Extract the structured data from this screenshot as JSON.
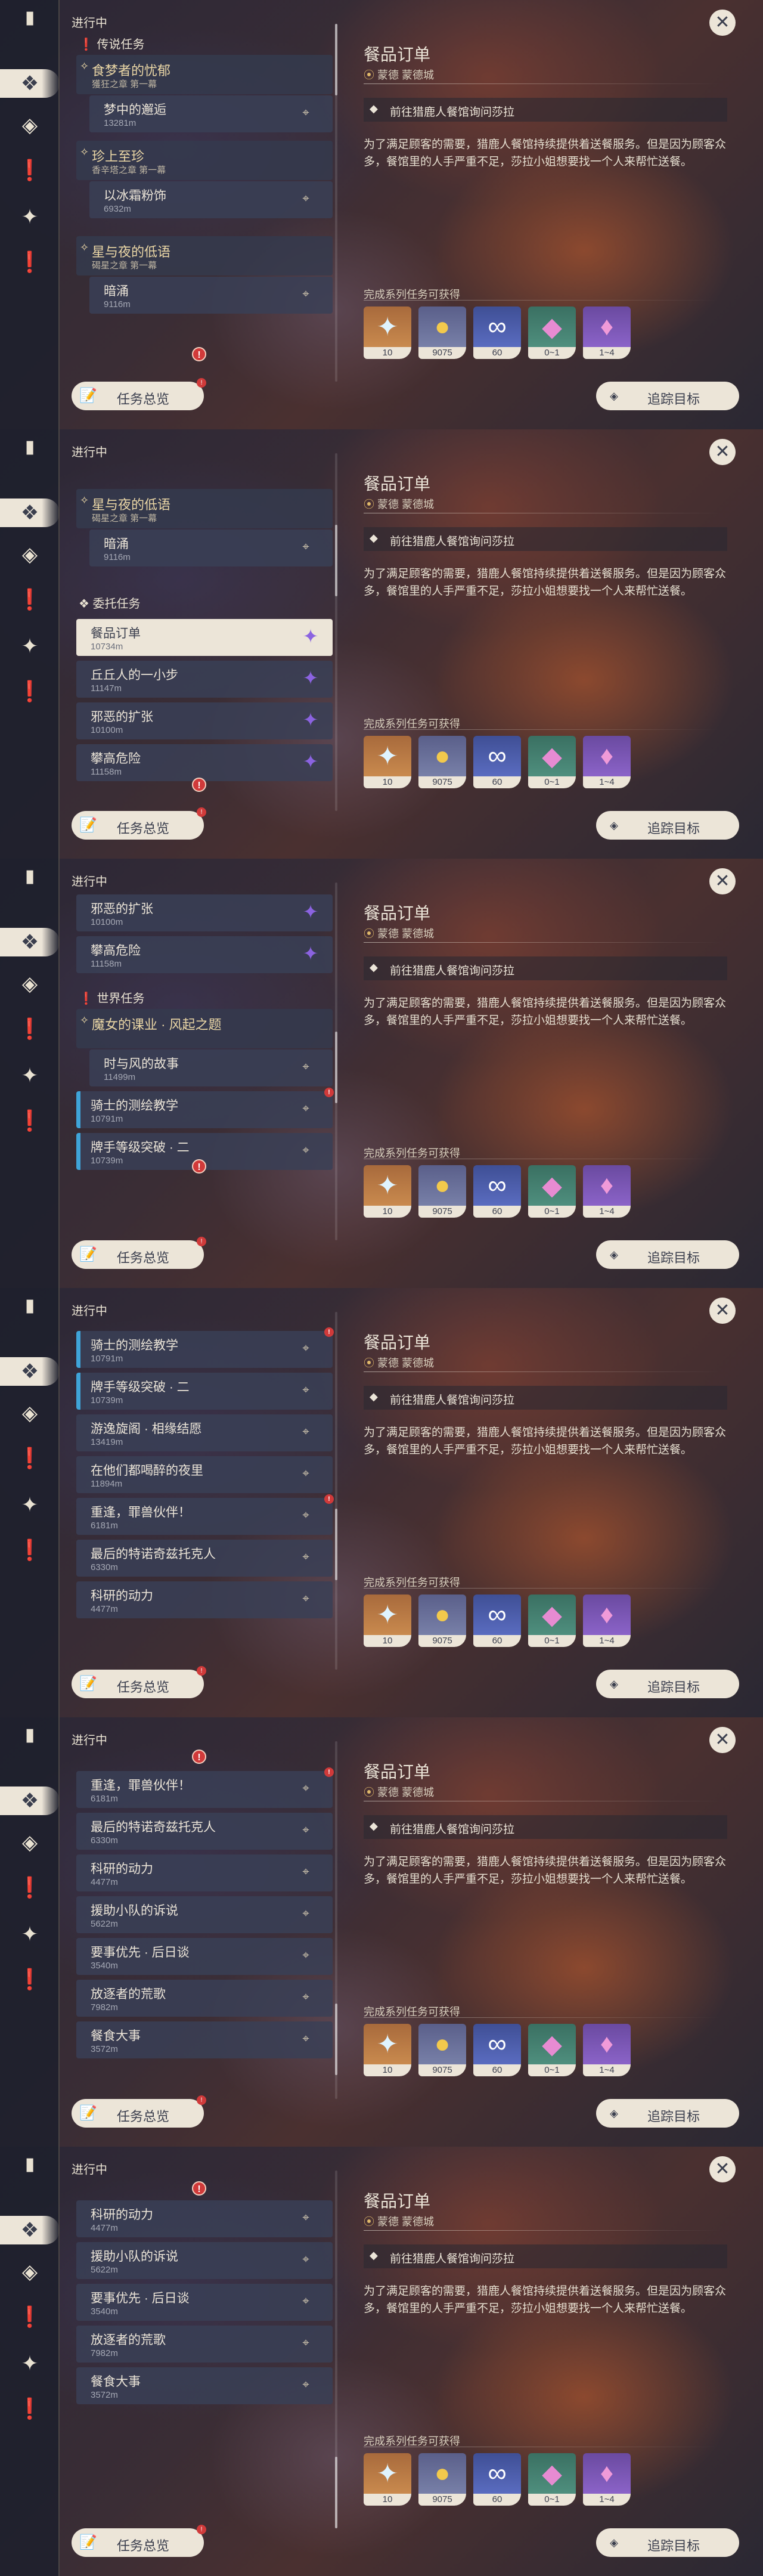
{
  "sidebar_icons": [
    "book-icon",
    "quest-diamond-icon",
    "compass-icon",
    "exclamation-icon",
    "crystal-icon",
    "exclamation-icon"
  ],
  "common": {
    "progress_label": "进行中",
    "overview_button": "任务总览",
    "track_button": "追踪目标",
    "close_glyph": "✕"
  },
  "detail": {
    "title": "餐品订单",
    "location_region": "蒙德",
    "location_city": "蒙德城",
    "step": "前往猎鹿人餐馆询问莎拉",
    "description": "为了满足顾客的需要，猎鹿人餐馆持续提供着送餐服务。但是因为顾客众多，餐馆里的人手严重不足，莎拉小姐想要找一个人来帮忙送餐。",
    "rewards_title": "完成系列任务可获得",
    "rewards": [
      {
        "icon": "primogem-icon",
        "count": "10"
      },
      {
        "icon": "mora-icon",
        "count": "9075"
      },
      {
        "icon": "hero-wit-icon",
        "count": "60"
      },
      {
        "icon": "crystal-chunk-icon",
        "count": "0~1"
      },
      {
        "icon": "amethyst-icon",
        "count": "1~4"
      }
    ]
  },
  "panels": [
    {
      "sections": [
        {
          "label": "传说任务"
        }
      ],
      "chapters": [
        {
          "title": "食梦者的忧郁",
          "sub": "獲狂之章 第一幕"
        },
        {
          "title": "珍上至珍",
          "sub": "香辛塔之章 第一幕"
        },
        {
          "title": "星与夜的低语",
          "sub": "碣星之章 第一幕"
        }
      ],
      "rows": [
        {
          "title": "梦中的邂逅",
          "dist": "13281m"
        },
        {
          "title": "以冰霜粉饰",
          "dist": "6932m"
        },
        {
          "title": "暗涌",
          "dist": "9116m"
        }
      ]
    },
    {
      "sections": [
        {
          "label": "委托任务"
        }
      ],
      "chapters": [
        {
          "title": "星与夜的低语",
          "sub": "碣星之章 第一幕"
        }
      ],
      "rows": [
        {
          "title": "暗涌",
          "dist": "9116m"
        },
        {
          "title": "餐品订单",
          "dist": "10734m"
        },
        {
          "title": "丘丘人的一小步",
          "dist": "11147m"
        },
        {
          "title": "邪恶的扩张",
          "dist": "10100m"
        },
        {
          "title": "攀高危险",
          "dist": "11158m"
        }
      ]
    },
    {
      "sections": [
        {
          "label": "世界任务"
        }
      ],
      "chapters": [
        {
          "title": "魔女的课业 · 风起之题",
          "sub": ""
        }
      ],
      "rows": [
        {
          "title": "邪恶的扩张",
          "dist": "10100m"
        },
        {
          "title": "攀高危险",
          "dist": "11158m"
        },
        {
          "title": "时与风的故事",
          "dist": "11499m"
        },
        {
          "title": "骑士的测绘教学",
          "dist": "10791m"
        },
        {
          "title": "牌手等级突破 · 二",
          "dist": "10739m"
        }
      ]
    },
    {
      "rows": [
        {
          "title": "骑士的测绘教学",
          "dist": "10791m"
        },
        {
          "title": "牌手等级突破 · 二",
          "dist": "10739m"
        },
        {
          "title": "游逸旋阁 · 相缘结愿",
          "dist": "13419m"
        },
        {
          "title": "在他们都喝醉的夜里",
          "dist": "11894m"
        },
        {
          "title": "重逢，罪兽伙伴！",
          "dist": "6181m"
        },
        {
          "title": "最后的特诺奇兹托克人",
          "dist": "6330m"
        },
        {
          "title": "科研的动力",
          "dist": "4477m"
        }
      ]
    },
    {
      "rows": [
        {
          "title": "重逢，罪兽伙伴！",
          "dist": "6181m"
        },
        {
          "title": "最后的特诺奇兹托克人",
          "dist": "6330m"
        },
        {
          "title": "科研的动力",
          "dist": "4477m"
        },
        {
          "title": "援助小队的诉说",
          "dist": "5622m"
        },
        {
          "title": "要事优先 · 后日谈",
          "dist": "3540m"
        },
        {
          "title": "放逐者的荒歌",
          "dist": "7982m"
        },
        {
          "title": "餐食大事",
          "dist": "3572m"
        }
      ]
    },
    {
      "rows": [
        {
          "title": "科研的动力",
          "dist": "4477m"
        },
        {
          "title": "援助小队的诉说",
          "dist": "5622m"
        },
        {
          "title": "要事优先 · 后日谈",
          "dist": "3540m"
        },
        {
          "title": "放逐者的荒歌",
          "dist": "7982m"
        },
        {
          "title": "餐食大事",
          "dist": "3572m"
        }
      ]
    }
  ]
}
